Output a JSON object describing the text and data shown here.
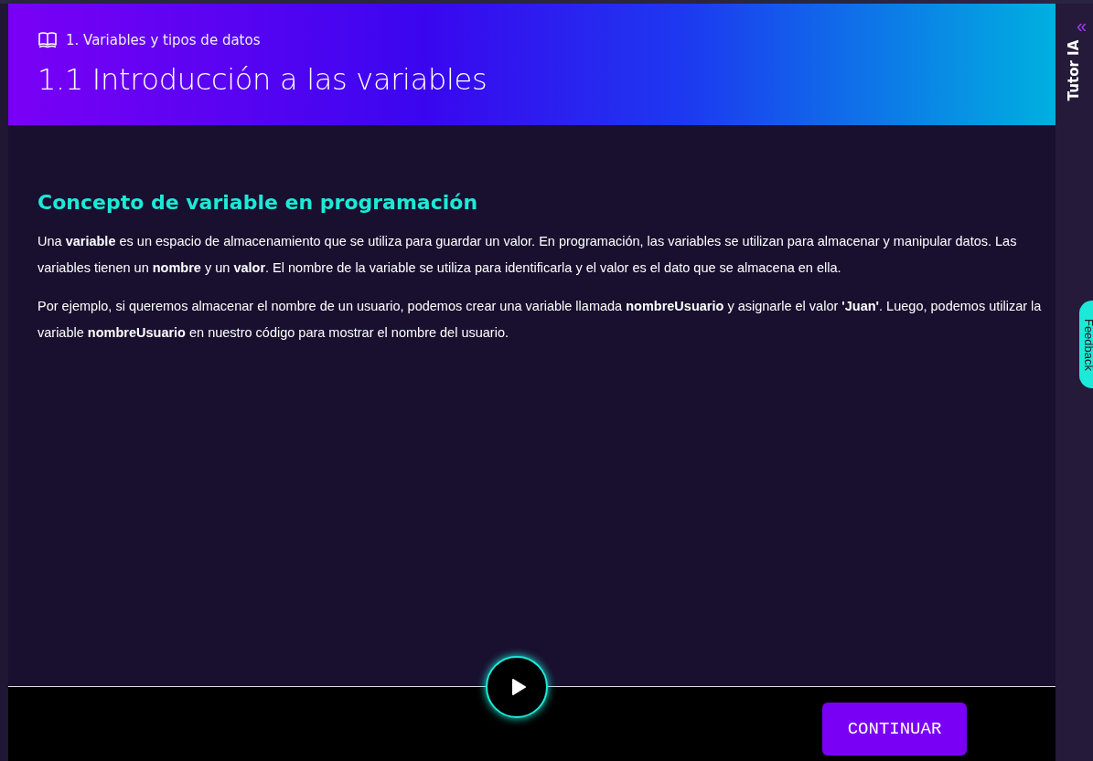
{
  "header": {
    "breadcrumb": "1. Variables y tipos de datos",
    "title": "1.1 Introducción a las variables"
  },
  "content": {
    "heading": "Concepto de variable en programación",
    "paragraphs": [
      "Una **variable** es un espacio de almacenamiento que se utiliza para guardar un valor. En programación, las variables se utilizan para almacenar y manipular datos. Las variables tienen un **nombre** y un **valor**. El nombre de la variable se utiliza para identificarla y el valor es el dato que se almacena en ella.",
      "Por ejemplo, si queremos almacenar el nombre de un usuario, podemos crear una variable llamada **nombreUsuario** y asignarle el valor **'Juan'**. Luego, podemos utilizar la variable **nombreUsuario** en nuestro código para mostrar el nombre del usuario."
    ]
  },
  "footer": {
    "button": "CONTINUAR"
  },
  "sidebar": {
    "collapse": "«",
    "title": "Tutor IA",
    "feedback": "Feedback"
  }
}
